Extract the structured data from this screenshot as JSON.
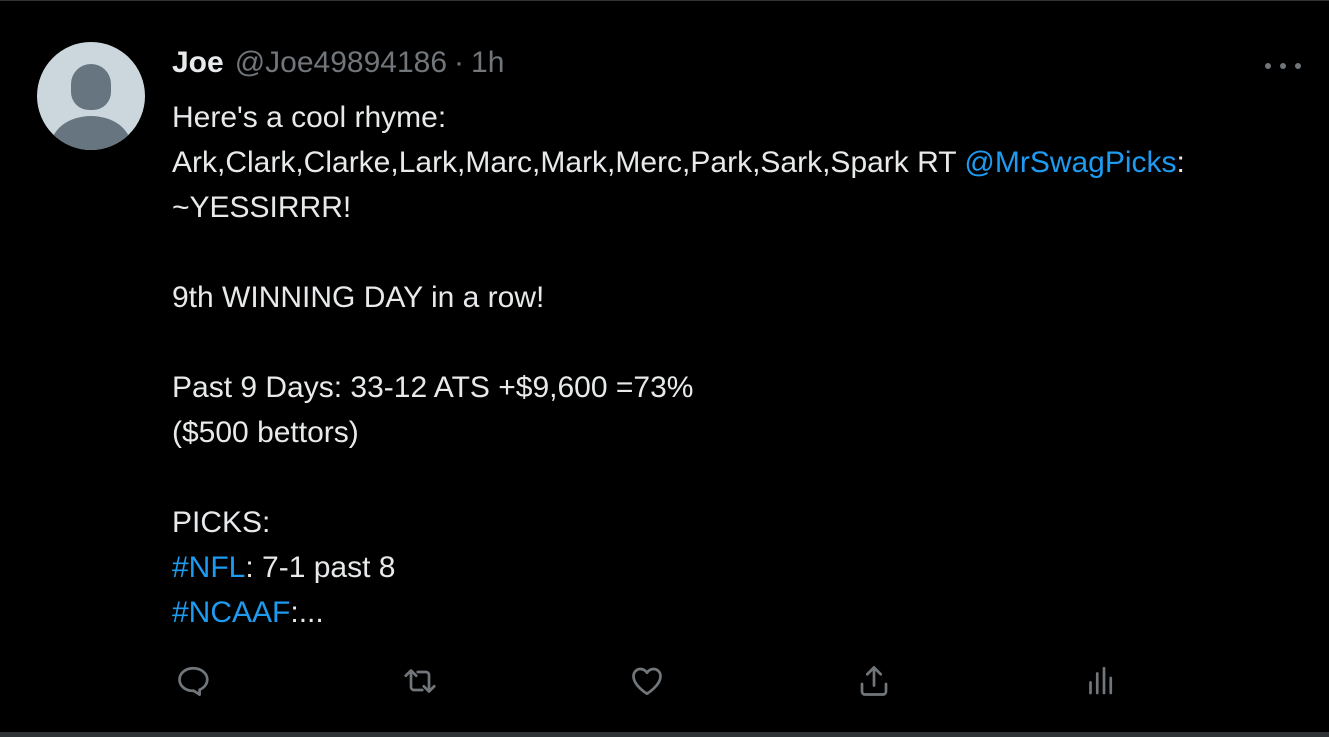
{
  "tweet": {
    "author_name": "Joe",
    "author_handle": "@Joe49894186",
    "separator": "·",
    "time": "1h",
    "lines": {
      "l1": "Here's a cool rhyme:",
      "l2_text": "Ark,Clark,Clarke,Lark,Marc,Mark,Merc,Park,Sark,Spark RT ",
      "l2_mention": "@MrSwagPicks",
      "l2_after": ":",
      "l3": "~YESSIRRR!",
      "l4": "9th WINNING DAY in a row!",
      "l5": "Past 9 Days: 33-12 ATS +$9,600 =73%",
      "l6": "($500 bettors)",
      "l7": "PICKS:",
      "l8_tag": "#NFL",
      "l8_text": ": 7-1 past 8",
      "l9_tag": "#NCAAF",
      "l9_text": ":..."
    }
  },
  "icons": {
    "more": "more-horizontal-icon",
    "reply": "reply-icon",
    "retweet": "retweet-icon",
    "like": "like-icon",
    "share": "share-icon",
    "analytics": "analytics-icon"
  },
  "colors": {
    "background": "#000000",
    "text": "#e7e9ea",
    "secondary": "#71767b",
    "link": "#1d9bf0",
    "avatar_bg": "#ccd6dd",
    "avatar_fg": "#66757f"
  }
}
